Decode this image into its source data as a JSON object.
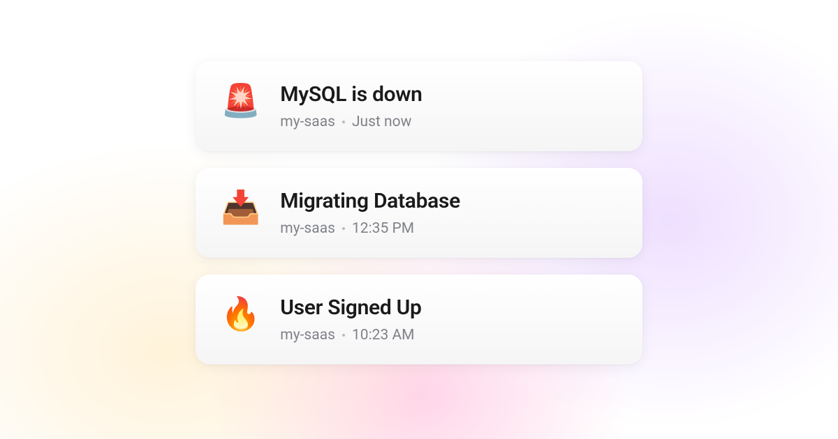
{
  "notifications": [
    {
      "icon": "🚨",
      "title": "MySQL is down",
      "project": "my-saas",
      "time": "Just now"
    },
    {
      "icon": "📥",
      "title": "Migrating Database",
      "project": "my-saas",
      "time": "12:35 PM"
    },
    {
      "icon": "🔥",
      "title": "User Signed Up",
      "project": "my-saas",
      "time": "10:23 AM"
    }
  ]
}
